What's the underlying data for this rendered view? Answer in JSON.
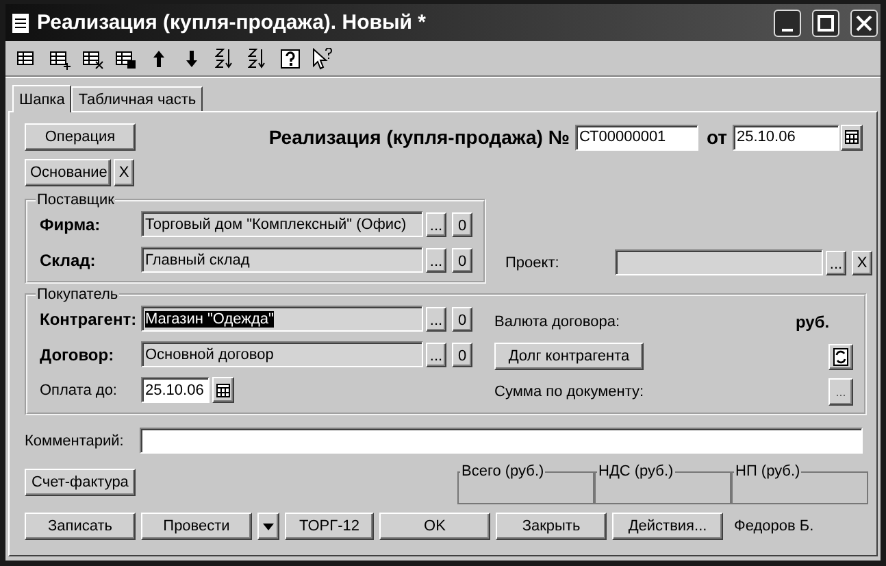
{
  "window": {
    "title": "Реализация (купля-продажа). Новый *"
  },
  "tabs": [
    {
      "label": "Шапка",
      "selected": true
    },
    {
      "label": "Табличная часть",
      "selected": false
    }
  ],
  "header": {
    "operation_button": "Операция",
    "basis_button": "Основание",
    "basis_clear": "X",
    "title": "Реализация (купля-продажа) №",
    "number": "СТ00000001",
    "date_label": "от",
    "date": "25.10.06"
  },
  "supplier": {
    "legend": "Поставщик",
    "fields": [
      {
        "label": "Фирма:",
        "bold": true,
        "value": "Торговый дом \"Комплексный\" (Офис)",
        "highlighted": false,
        "select_button": "...",
        "open_button": "0"
      },
      {
        "label": "Склад:",
        "bold": true,
        "value": "Главный склад",
        "highlighted": false,
        "select_button": "...",
        "open_button": "0"
      }
    ]
  },
  "project": {
    "label": "Проект:",
    "select_button": "...",
    "clear_button": "X"
  },
  "buyer": {
    "legend": "Покупатель",
    "fields": [
      {
        "label": "Контрагент:",
        "bold": true,
        "value": "Магазин \"Одежда\"",
        "highlighted": true,
        "select_button": "...",
        "open_button": "0"
      },
      {
        "label": "Договор:",
        "bold": true,
        "value": "Основной договор",
        "highlighted": false,
        "select_button": "...",
        "open_button": "0"
      }
    ],
    "payment": {
      "label": "Оплата до:",
      "bold": false,
      "value": "25.10.06"
    },
    "currency_label": "Валюта договора:",
    "currency": "руб.",
    "debt_button": "Долг контрагента",
    "sum_label": "Сумма по документу:",
    "sum_button": "..."
  },
  "comment": {
    "label": "Комментарий:"
  },
  "invoice_button": "Счет-фактура",
  "totals": [
    {
      "legend": "Всего (руб.)"
    },
    {
      "legend": "НДС (руб.)"
    },
    {
      "legend": "НП (руб.)"
    }
  ],
  "buttons": [
    {
      "kind": "button",
      "label": "Записать"
    },
    {
      "kind": "button",
      "label": "Провести"
    },
    {
      "kind": "dropdown"
    },
    {
      "kind": "button",
      "label": "ТОРГ-12"
    },
    {
      "kind": "button",
      "label": "OK"
    },
    {
      "kind": "button",
      "label": "Закрыть"
    },
    {
      "kind": "button",
      "label": "Действия..."
    }
  ],
  "author": "Федоров Б."
}
